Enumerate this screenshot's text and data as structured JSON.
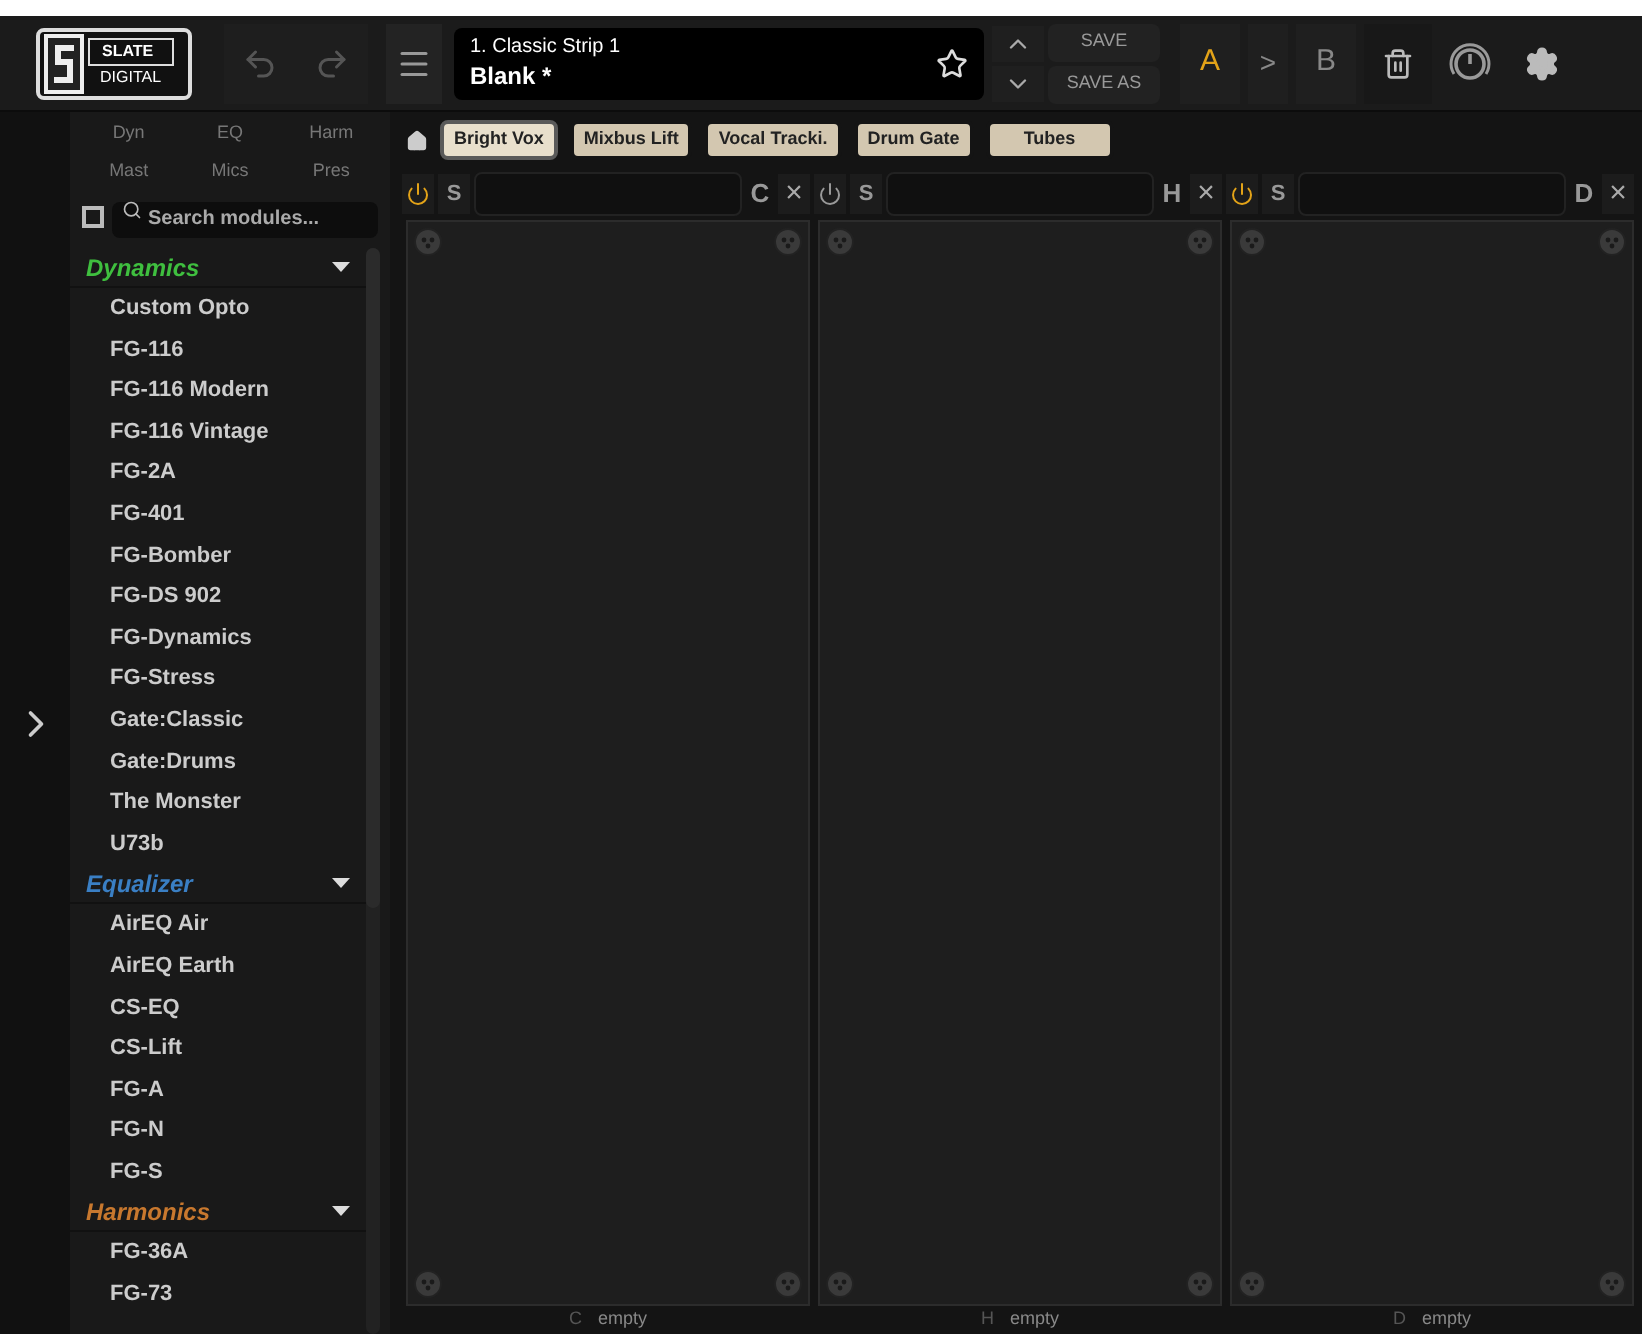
{
  "logo": {
    "line_1": "SLATE",
    "line_2": "DIGITAL"
  },
  "preset": {
    "bank": "1. Classic Strip 1",
    "name": "Blank *",
    "favorite": false
  },
  "save_buttons": [
    "SAVE",
    "SAVE AS"
  ],
  "ab": {
    "a": {
      "label": "A",
      "selected": true
    },
    "arrow": ">",
    "b": {
      "label": "B",
      "selected": false
    }
  },
  "filters": [
    {
      "label": "Dyn"
    },
    {
      "label": "EQ"
    },
    {
      "label": "Harm"
    },
    {
      "label": "Mast"
    },
    {
      "label": "Mics"
    },
    {
      "label": "Pres"
    }
  ],
  "search": {
    "placeholder": "Search modules...",
    "checked": false
  },
  "categories": [
    {
      "name": "Dynamics",
      "color": "#3fbf3f",
      "expanded": true,
      "items": [
        "Custom Opto",
        "FG-116",
        "FG-116 Modern",
        "FG-116 Vintage",
        "FG-2A",
        "FG-401",
        "FG-Bomber",
        "FG-DS 902",
        "FG-Dynamics",
        "FG-Stress",
        "Gate:Classic",
        "Gate:Drums",
        "The Monster",
        "U73b"
      ]
    },
    {
      "name": "Equalizer",
      "color": "#3a7fc4",
      "expanded": true,
      "items": [
        "AirEQ Air",
        "AirEQ Earth",
        "CS-EQ",
        "CS-Lift",
        "FG-A",
        "FG-N",
        "FG-S"
      ]
    },
    {
      "name": "Harmonics",
      "color": "#c8782e",
      "expanded": true,
      "items": [
        "FG-36A",
        "FG-73"
      ]
    }
  ],
  "quick_presets": [
    {
      "label": "Bright Vox",
      "selected": true
    },
    {
      "label": "Mixbus Lift",
      "selected": false
    },
    {
      "label": "Vocal Tracki.",
      "selected": false
    },
    {
      "label": "Drum Gate",
      "selected": false
    },
    {
      "label": "Tubes",
      "selected": false
    }
  ],
  "slots": [
    {
      "solo": "S",
      "letter": "C",
      "close": "×",
      "on": true,
      "footer_letter": "C",
      "footer_text": "empty"
    },
    {
      "solo": "S",
      "letter": "H",
      "close": "×",
      "on": false,
      "footer_letter": "H",
      "footer_text": "empty"
    },
    {
      "solo": "S",
      "letter": "D",
      "close": "×",
      "on": true,
      "footer_letter": "D",
      "footer_text": "empty"
    }
  ]
}
